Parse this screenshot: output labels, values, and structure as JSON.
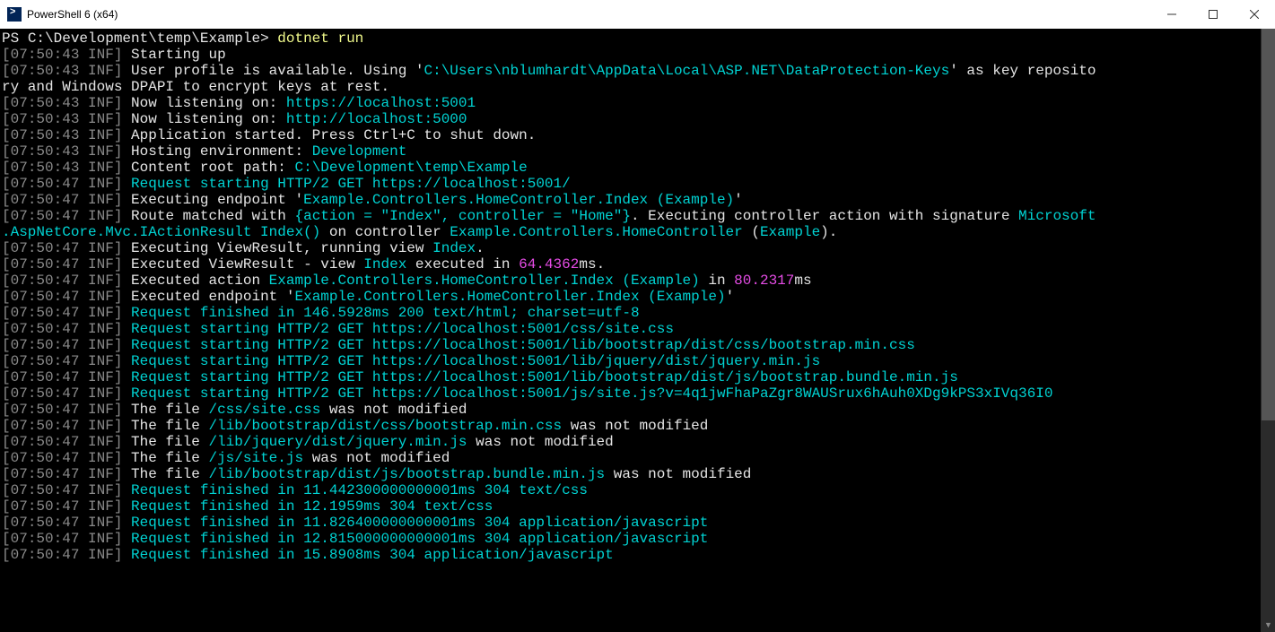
{
  "window": {
    "title": "PowerShell 6 (x64)",
    "minimize_label": "Minimize",
    "maximize_label": "Maximize",
    "close_label": "Close"
  },
  "prompt": {
    "ps": "PS ",
    "path": "C:\\Development\\temp\\Example",
    "arrow": ">",
    "command": "dotnet run"
  },
  "lines": [
    {
      "ts": "07:50:43",
      "lvl": "INF",
      "spans": [
        {
          "t": "Starting up",
          "c": "default"
        }
      ]
    },
    {
      "ts": "07:50:43",
      "lvl": "INF",
      "spans": [
        {
          "t": "User profile is available. Using '",
          "c": "default"
        },
        {
          "t": "C:\\Users\\nblumhardt\\AppData\\Local\\ASP.NET\\DataProtection-Keys",
          "c": "cyan"
        },
        {
          "t": "' as key reposito",
          "c": "default"
        }
      ],
      "wrap": [
        {
          "t": "ry and Windows DPAPI to encrypt keys at rest.",
          "c": "default"
        }
      ]
    },
    {
      "ts": "07:50:43",
      "lvl": "INF",
      "spans": [
        {
          "t": "Now listening on: ",
          "c": "default"
        },
        {
          "t": "https://localhost:5001",
          "c": "cyan"
        }
      ]
    },
    {
      "ts": "07:50:43",
      "lvl": "INF",
      "spans": [
        {
          "t": "Now listening on: ",
          "c": "default"
        },
        {
          "t": "http://localhost:5000",
          "c": "cyan"
        }
      ]
    },
    {
      "ts": "07:50:43",
      "lvl": "INF",
      "spans": [
        {
          "t": "Application started. Press Ctrl+C to shut down.",
          "c": "default"
        }
      ]
    },
    {
      "ts": "07:50:43",
      "lvl": "INF",
      "spans": [
        {
          "t": "Hosting environment: ",
          "c": "default"
        },
        {
          "t": "Development",
          "c": "cyan"
        }
      ]
    },
    {
      "ts": "07:50:43",
      "lvl": "INF",
      "spans": [
        {
          "t": "Content root path: ",
          "c": "default"
        },
        {
          "t": "C:\\Development\\temp\\Example",
          "c": "cyan"
        }
      ]
    },
    {
      "ts": "07:50:47",
      "lvl": "INF",
      "spans": [
        {
          "t": "Request starting HTTP/2 GET https://localhost:5001/",
          "c": "cyan"
        }
      ]
    },
    {
      "ts": "07:50:47",
      "lvl": "INF",
      "spans": [
        {
          "t": "Executing endpoint '",
          "c": "default"
        },
        {
          "t": "Example.Controllers.HomeController.Index (Example)",
          "c": "cyan"
        },
        {
          "t": "'",
          "c": "default"
        }
      ]
    },
    {
      "ts": "07:50:47",
      "lvl": "INF",
      "spans": [
        {
          "t": "Route matched with ",
          "c": "default"
        },
        {
          "t": "{action = \"Index\", controller = \"Home\"}",
          "c": "cyan"
        },
        {
          "t": ". Executing controller action with signature ",
          "c": "default"
        },
        {
          "t": "Microsoft",
          "c": "cyan"
        }
      ],
      "wrap": [
        {
          "t": ".AspNetCore.Mvc.IActionResult Index()",
          "c": "cyan"
        },
        {
          "t": " on controller ",
          "c": "default"
        },
        {
          "t": "Example.Controllers.HomeController",
          "c": "cyan"
        },
        {
          "t": " (",
          "c": "default"
        },
        {
          "t": "Example",
          "c": "cyan"
        },
        {
          "t": ").",
          "c": "default"
        }
      ]
    },
    {
      "ts": "07:50:47",
      "lvl": "INF",
      "spans": [
        {
          "t": "Executing ViewResult, running view ",
          "c": "default"
        },
        {
          "t": "Index",
          "c": "cyan"
        },
        {
          "t": ".",
          "c": "default"
        }
      ]
    },
    {
      "ts": "07:50:47",
      "lvl": "INF",
      "spans": [
        {
          "t": "Executed ViewResult - view ",
          "c": "default"
        },
        {
          "t": "Index",
          "c": "cyan"
        },
        {
          "t": " executed in ",
          "c": "default"
        },
        {
          "t": "64.4362",
          "c": "magenta"
        },
        {
          "t": "ms.",
          "c": "default"
        }
      ]
    },
    {
      "ts": "07:50:47",
      "lvl": "INF",
      "spans": [
        {
          "t": "Executed action ",
          "c": "default"
        },
        {
          "t": "Example.Controllers.HomeController.Index (Example)",
          "c": "cyan"
        },
        {
          "t": " in ",
          "c": "default"
        },
        {
          "t": "80.2317",
          "c": "magenta"
        },
        {
          "t": "ms",
          "c": "default"
        }
      ]
    },
    {
      "ts": "07:50:47",
      "lvl": "INF",
      "spans": [
        {
          "t": "Executed endpoint '",
          "c": "default"
        },
        {
          "t": "Example.Controllers.HomeController.Index (Example)",
          "c": "cyan"
        },
        {
          "t": "'",
          "c": "default"
        }
      ]
    },
    {
      "ts": "07:50:47",
      "lvl": "INF",
      "spans": [
        {
          "t": "Request finished in 146.5928ms 200 text/html; charset=utf-8",
          "c": "cyan"
        }
      ]
    },
    {
      "ts": "07:50:47",
      "lvl": "INF",
      "spans": [
        {
          "t": "Request starting HTTP/2 GET https://localhost:5001/css/site.css",
          "c": "cyan"
        }
      ]
    },
    {
      "ts": "07:50:47",
      "lvl": "INF",
      "spans": [
        {
          "t": "Request starting HTTP/2 GET https://localhost:5001/lib/bootstrap/dist/css/bootstrap.min.css",
          "c": "cyan"
        }
      ]
    },
    {
      "ts": "07:50:47",
      "lvl": "INF",
      "spans": [
        {
          "t": "Request starting HTTP/2 GET https://localhost:5001/lib/jquery/dist/jquery.min.js",
          "c": "cyan"
        }
      ]
    },
    {
      "ts": "07:50:47",
      "lvl": "INF",
      "spans": [
        {
          "t": "Request starting HTTP/2 GET https://localhost:5001/lib/bootstrap/dist/js/bootstrap.bundle.min.js",
          "c": "cyan"
        }
      ]
    },
    {
      "ts": "07:50:47",
      "lvl": "INF",
      "spans": [
        {
          "t": "Request starting HTTP/2 GET https://localhost:5001/js/site.js?v=4q1jwFhaPaZgr8WAUSrux6hAuh0XDg9kPS3xIVq36I0",
          "c": "cyan"
        }
      ]
    },
    {
      "ts": "07:50:47",
      "lvl": "INF",
      "spans": [
        {
          "t": "The file ",
          "c": "default"
        },
        {
          "t": "/css/site.css",
          "c": "cyan"
        },
        {
          "t": " was not modified",
          "c": "default"
        }
      ]
    },
    {
      "ts": "07:50:47",
      "lvl": "INF",
      "spans": [
        {
          "t": "The file ",
          "c": "default"
        },
        {
          "t": "/lib/bootstrap/dist/css/bootstrap.min.css",
          "c": "cyan"
        },
        {
          "t": " was not modified",
          "c": "default"
        }
      ]
    },
    {
      "ts": "07:50:47",
      "lvl": "INF",
      "spans": [
        {
          "t": "The file ",
          "c": "default"
        },
        {
          "t": "/lib/jquery/dist/jquery.min.js",
          "c": "cyan"
        },
        {
          "t": " was not modified",
          "c": "default"
        }
      ]
    },
    {
      "ts": "07:50:47",
      "lvl": "INF",
      "spans": [
        {
          "t": "The file ",
          "c": "default"
        },
        {
          "t": "/js/site.js",
          "c": "cyan"
        },
        {
          "t": " was not modified",
          "c": "default"
        }
      ]
    },
    {
      "ts": "07:50:47",
      "lvl": "INF",
      "spans": [
        {
          "t": "The file ",
          "c": "default"
        },
        {
          "t": "/lib/bootstrap/dist/js/bootstrap.bundle.min.js",
          "c": "cyan"
        },
        {
          "t": " was not modified",
          "c": "default"
        }
      ]
    },
    {
      "ts": "07:50:47",
      "lvl": "INF",
      "spans": [
        {
          "t": "Request finished in 11.442300000000001ms 304 text/css",
          "c": "cyan"
        }
      ]
    },
    {
      "ts": "07:50:47",
      "lvl": "INF",
      "spans": [
        {
          "t": "Request finished in 12.1959ms 304 text/css",
          "c": "cyan"
        }
      ]
    },
    {
      "ts": "07:50:47",
      "lvl": "INF",
      "spans": [
        {
          "t": "Request finished in 11.826400000000001ms 304 application/javascript",
          "c": "cyan"
        }
      ]
    },
    {
      "ts": "07:50:47",
      "lvl": "INF",
      "spans": [
        {
          "t": "Request finished in 12.815000000000001ms 304 application/javascript",
          "c": "cyan"
        }
      ]
    },
    {
      "ts": "07:50:47",
      "lvl": "INF",
      "spans": [
        {
          "t": "Request finished in 15.8908ms 304 application/javascript",
          "c": "cyan"
        }
      ]
    }
  ]
}
